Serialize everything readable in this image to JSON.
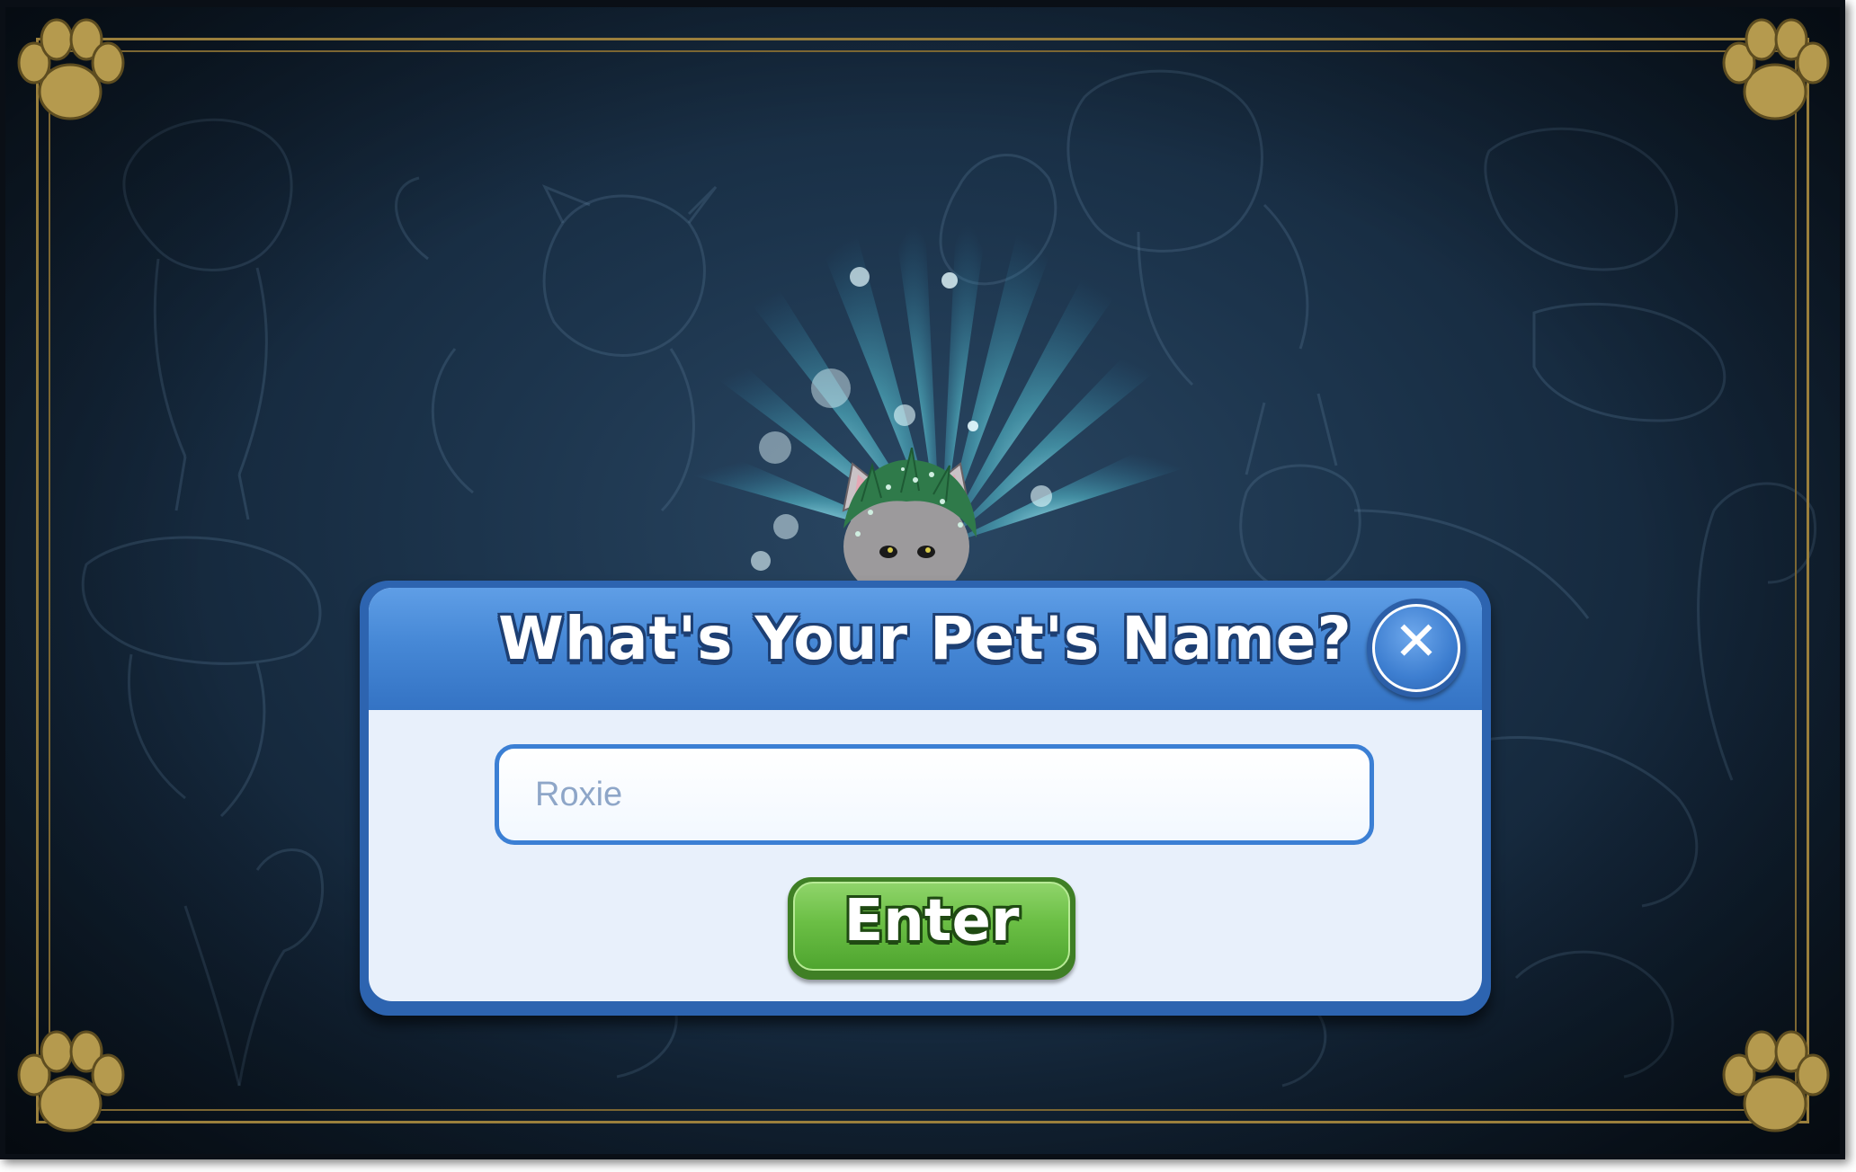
{
  "dialog": {
    "title": "What's Your Pet's Name?",
    "close_icon": "close-icon",
    "name_input": {
      "value": "",
      "placeholder": "Roxie"
    },
    "enter_label": "Enter"
  },
  "decor": {
    "corner_icon": "paw-print-icon",
    "background_theme": "pet sketch chalkboard",
    "pet_icon": "kitten-pet-icon"
  },
  "colors": {
    "dialog_header": "#4688d6",
    "dialog_body": "#e8f0fb",
    "enter_button": "#6bbf45",
    "frame_gold": "#9a7f3c",
    "background": "#1c344c"
  }
}
